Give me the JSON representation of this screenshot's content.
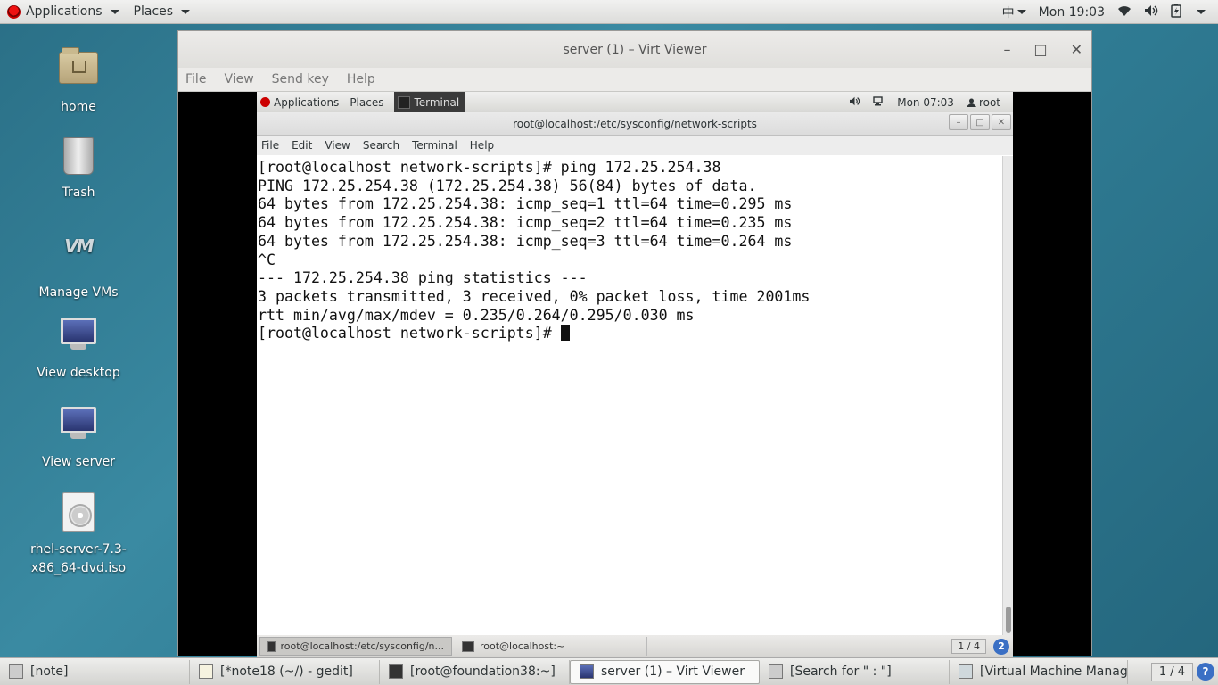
{
  "host_panel": {
    "applications_label": "Applications",
    "places_label": "Places",
    "input_method": "中",
    "clock": "Mon 19:03"
  },
  "desktop_icons": [
    {
      "label": "home"
    },
    {
      "label": "Trash"
    },
    {
      "label": "Manage VMs"
    },
    {
      "label": "View desktop"
    },
    {
      "label": "View server"
    },
    {
      "label": "rhel-server-7.3-x86_64-dvd.iso"
    }
  ],
  "viewer": {
    "title": "server (1) – Virt Viewer",
    "menu": [
      "File",
      "View",
      "Send key",
      "Help"
    ]
  },
  "guest_panel": {
    "applications_label": "Applications",
    "places_label": "Places",
    "terminal_label": "Terminal",
    "clock": "Mon 07:03",
    "user": "root"
  },
  "guest_terminal": {
    "title": "root@localhost:/etc/sysconfig/network-scripts",
    "menu": [
      "File",
      "Edit",
      "View",
      "Search",
      "Terminal",
      "Help"
    ],
    "lines": [
      "[root@localhost network-scripts]# ping 172.25.254.38",
      "PING 172.25.254.38 (172.25.254.38) 56(84) bytes of data.",
      "64 bytes from 172.25.254.38: icmp_seq=1 ttl=64 time=0.295 ms",
      "64 bytes from 172.25.254.38: icmp_seq=2 ttl=64 time=0.235 ms",
      "64 bytes from 172.25.254.38: icmp_seq=3 ttl=64 time=0.264 ms",
      "^C",
      "--- 172.25.254.38 ping statistics ---",
      "3 packets transmitted, 3 received, 0% packet loss, time 2001ms",
      "rtt min/avg/max/mdev = 0.235/0.264/0.295/0.030 ms"
    ],
    "prompt": "[root@localhost network-scripts]# "
  },
  "guest_taskbar": {
    "tasks": [
      {
        "label": "root@localhost:/etc/sysconfig/n..."
      },
      {
        "label": "root@localhost:~"
      }
    ],
    "pager": "1 / 4"
  },
  "host_taskbar": {
    "tasks": [
      {
        "label": "[note]"
      },
      {
        "label": "[*note18 (~/) - gedit]"
      },
      {
        "label": "[root@foundation38:~]"
      },
      {
        "label": "server (1) – Virt Viewer"
      },
      {
        "label": "[Search for \" : \"]"
      },
      {
        "label": "[Virtual Machine Manager]"
      }
    ],
    "pager": "1 / 4"
  }
}
